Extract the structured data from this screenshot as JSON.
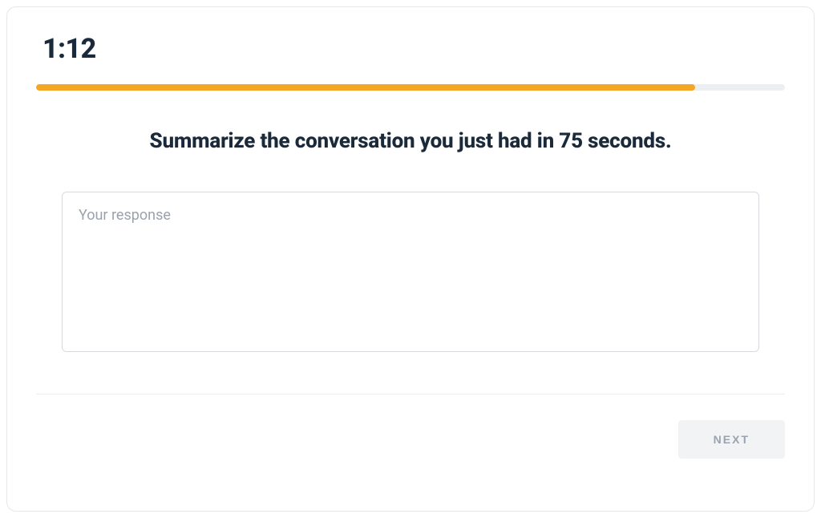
{
  "timer": "1:12",
  "progress_percent": 88,
  "prompt": "Summarize the conversation you just had in 75 seconds.",
  "response": {
    "placeholder": "Your response",
    "value": ""
  },
  "footer": {
    "next_label": "NEXT"
  },
  "colors": {
    "accent": "#f5a623",
    "text_dark": "#1a2a3a",
    "muted": "#9aa3ad",
    "border": "#d7dbe0",
    "track": "#eceff1",
    "btn_bg": "#f1f3f5"
  }
}
